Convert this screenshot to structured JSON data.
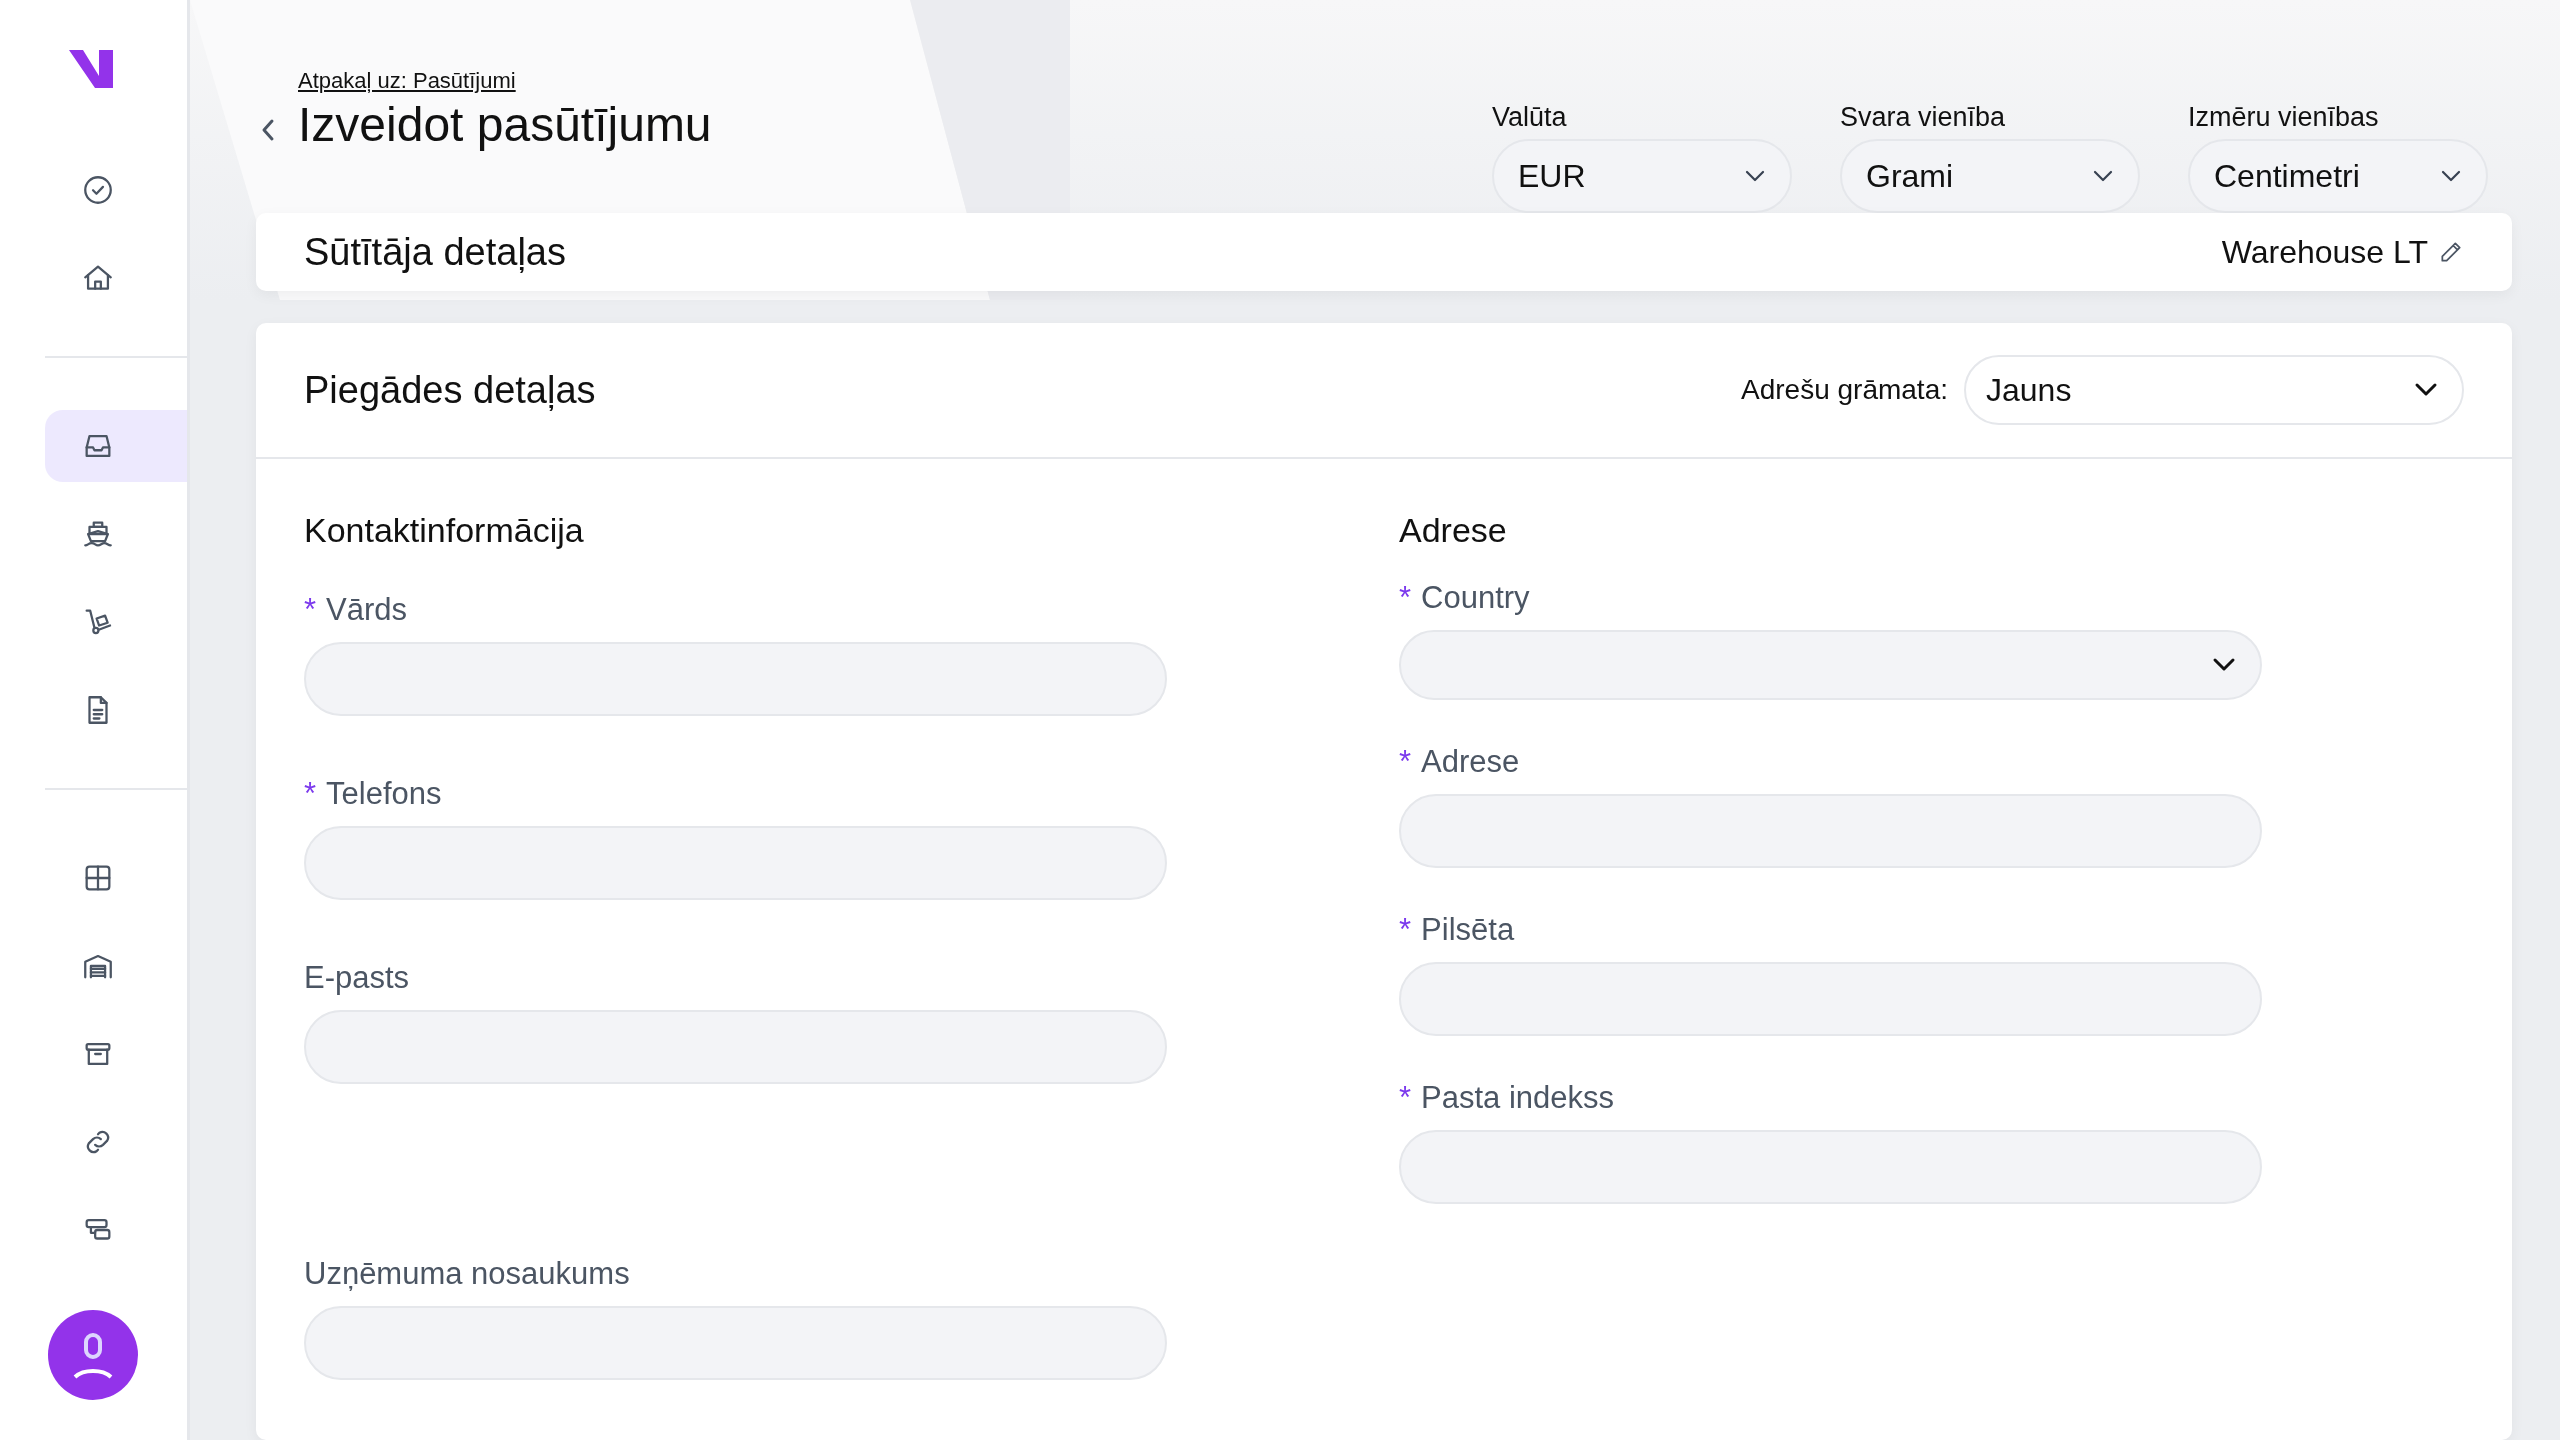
{
  "sidebar": {
    "groups": [
      [
        {
          "selected": false
        },
        {
          "selected": false
        }
      ],
      [
        {
          "selected": true
        },
        {
          "selected": false
        },
        {
          "selected": false
        },
        {
          "selected": false
        }
      ],
      [
        {
          "selected": false
        },
        {
          "selected": false
        },
        {
          "selected": false
        },
        {
          "selected": false
        },
        {
          "selected": false
        }
      ]
    ]
  },
  "header": {
    "back_link": "Atpakaļ uz: Pasūtījumi",
    "title": "Izveidot pasūtījumu",
    "selects": [
      {
        "label": "Valūta",
        "value": "EUR"
      },
      {
        "label": "Svara vienība",
        "value": "Grami"
      },
      {
        "label": "Izmēru vienības",
        "value": "Centimetri"
      }
    ]
  },
  "sender_card": {
    "title": "Sūtītāja detaļas",
    "value": "Warehouse LT"
  },
  "delivery_card": {
    "title": "Piegādes detaļas",
    "address_book_label": "Adrešu grāmata:",
    "address_book_value": "Jauns",
    "columns": [
      {
        "title": "Kontaktinformācija",
        "fields": [
          {
            "kind": "text",
            "required_mark": "*",
            "label": "Vārds"
          },
          {
            "kind": "text",
            "required_mark": "*",
            "label": "Telefons"
          },
          {
            "kind": "text",
            "label": "E-pasts"
          },
          {
            "kind": "text",
            "label": "Uzņēmuma nosaukums"
          }
        ]
      },
      {
        "title": "Adrese",
        "fields": [
          {
            "kind": "select",
            "required_mark": "*",
            "label": "Country"
          },
          {
            "kind": "text",
            "required_mark": "*",
            "label": "Adrese"
          },
          {
            "kind": "text",
            "required_mark": "*",
            "label": "Pilsēta"
          },
          {
            "kind": "text",
            "required_mark": "*",
            "label": "Pasta indekss"
          }
        ]
      }
    ]
  }
}
